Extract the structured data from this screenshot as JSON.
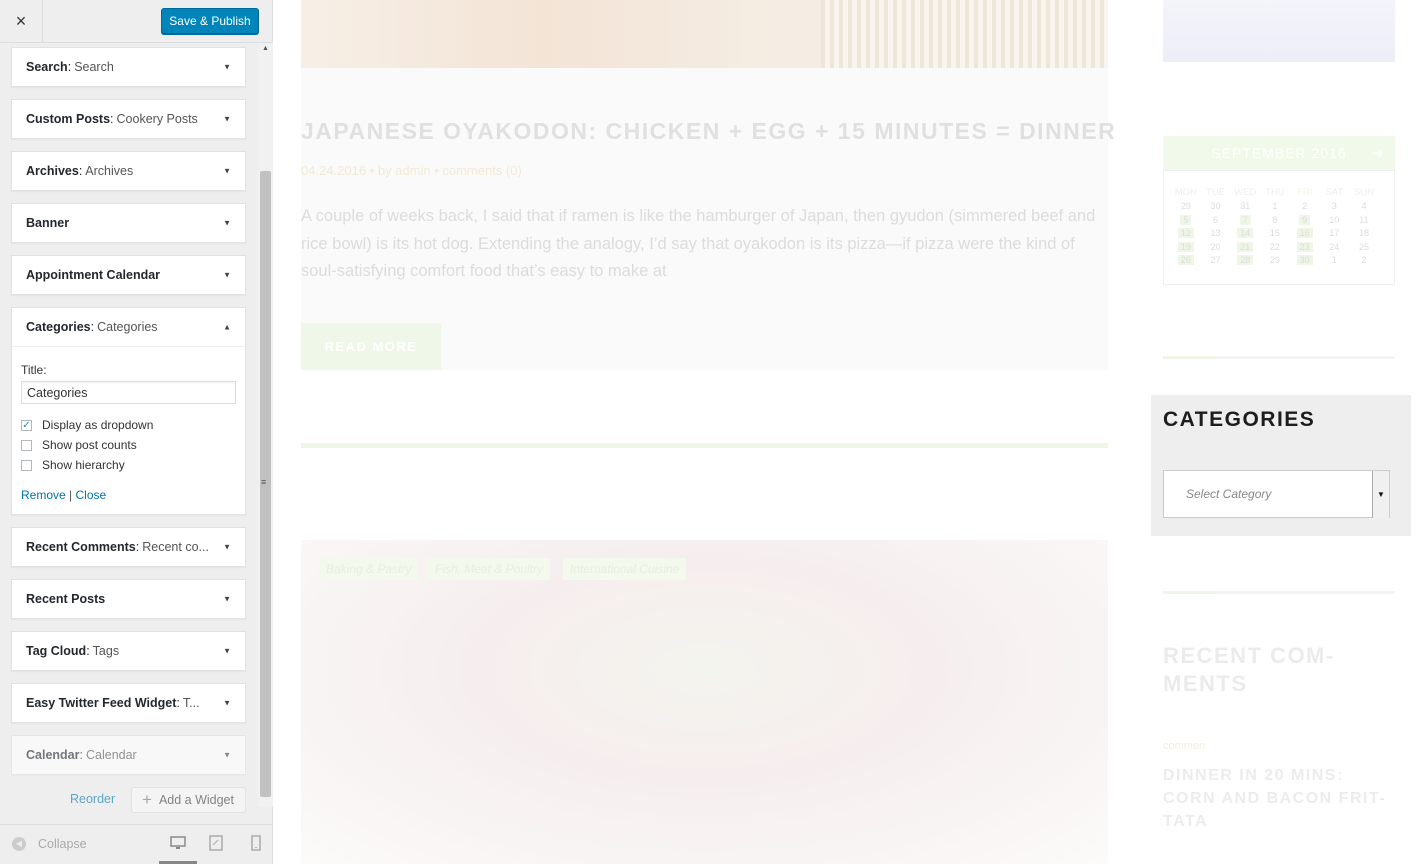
{
  "topbar": {
    "close_label": "×",
    "publish_label": "Save & Publish"
  },
  "widgets": [
    {
      "name": "Search",
      "sub": "Search"
    },
    {
      "name": "Custom Posts",
      "sub": "Cookery Posts"
    },
    {
      "name": "Archives",
      "sub": "Archives"
    },
    {
      "name": "Banner",
      "sub": ""
    },
    {
      "name": "Appointment Calendar",
      "sub": ""
    },
    {
      "name": "Categories",
      "sub": "Categories"
    },
    {
      "name": "Recent Comments",
      "sub": "Recent co..."
    },
    {
      "name": "Recent Posts",
      "sub": ""
    },
    {
      "name": "Tag Cloud",
      "sub": "Tags"
    },
    {
      "name": "Easy Twitter Feed Widget",
      "sub": "T..."
    },
    {
      "name": "Calendar",
      "sub": "Calendar"
    }
  ],
  "categories_form": {
    "title_label": "Title:",
    "title_value": "Categories",
    "options": [
      {
        "label": "Display as dropdown",
        "checked": true
      },
      {
        "label": "Show post counts",
        "checked": false
      },
      {
        "label": "Show hierarchy",
        "checked": false
      }
    ],
    "remove_label": "Remove",
    "separator": "|",
    "close_label": "Close"
  },
  "footer": {
    "reorder_label": "Reorder",
    "add_widget_label": "Add a Widget"
  },
  "bottombar": {
    "collapse_label": "Collapse"
  },
  "preview": {
    "post_title": "JAPANESE OYAKODON: CHICKEN + EGG + 15 MINUTES = DINNER",
    "post_meta": "04.24.2016  •  by admin  •  comments (0)",
    "post_excerpt": "A couple of weeks back, I said that if ramen is like the hamburger of Japan, then gyudon (simmered beef and rice bowl) is its hot dog. Extending the analogy, I’d say that oyakodon is its pizza—if pizza were the kind of soul-satisfying comfort food that’s easy to make at",
    "read_more": "READ MORE",
    "tags": [
      "Baking & Pastry",
      "Fish, Meat & Poultry",
      "International Cuisine"
    ],
    "calendar": {
      "month": "SEPTEMBER 2016",
      "next_icon": "arrow-right",
      "days": [
        "MON",
        "TUE",
        "WED",
        "THU",
        "FRI",
        "SAT",
        "SUN"
      ],
      "weeks": [
        [
          "29",
          "30",
          "31",
          "1",
          "2",
          "3",
          "4"
        ],
        [
          "5",
          "6",
          "7",
          "8",
          "9",
          "10",
          "11"
        ],
        [
          "12",
          "13",
          "14",
          "15",
          "16",
          "17",
          "18"
        ],
        [
          "19",
          "20",
          "21",
          "22",
          "23",
          "24",
          "25"
        ],
        [
          "26",
          "27",
          "28",
          "29",
          "30",
          "1",
          "2"
        ]
      ]
    },
    "categories_heading": "CATEGORIES",
    "select_placeholder": "Select Category",
    "recent_comments_heading": "RECENT COM-MENTS",
    "rc_label": "commen",
    "rc_post": "DINNER IN 20 MINS: CORN AND BACON FRIT-TATA"
  }
}
